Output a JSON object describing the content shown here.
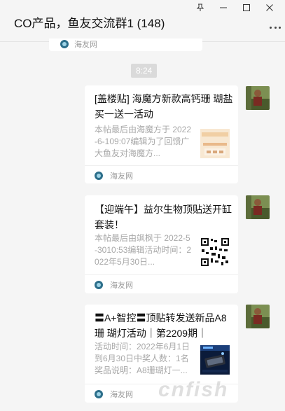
{
  "window": {
    "title": "CO产品，鱼友交流群1 (148)",
    "controls": [
      "pin-icon",
      "minimize-icon",
      "maximize-icon",
      "close-icon"
    ]
  },
  "previous_card": {
    "source": "海友网"
  },
  "time_separator": "8:24",
  "messages": [
    {
      "title": "[盖楼贴] 海魔方新款高钙珊 瑚盐买一送一活动",
      "description": "本帖最后由海魔方于 2022-6-109:07编辑为了回馈广大鱼友对海魔方...",
      "source": "海友网"
    },
    {
      "title": "【迎端午】益尔生物顶贴送开缸套装！",
      "description": "本帖最后由飒枫于 2022-5-3010:53编辑活动时间：2022年5月30日...",
      "source": "海友网"
    },
    {
      "title": "〓A+智控〓顶贴转发送新品A8珊 瑚灯活动｜第2209期｜",
      "description": "活动时间：2022年6月1日到6月30日中奖人数：1名奖品说明：A8珊瑚灯一...",
      "source": "海友网"
    }
  ],
  "watermark": "cnfish"
}
